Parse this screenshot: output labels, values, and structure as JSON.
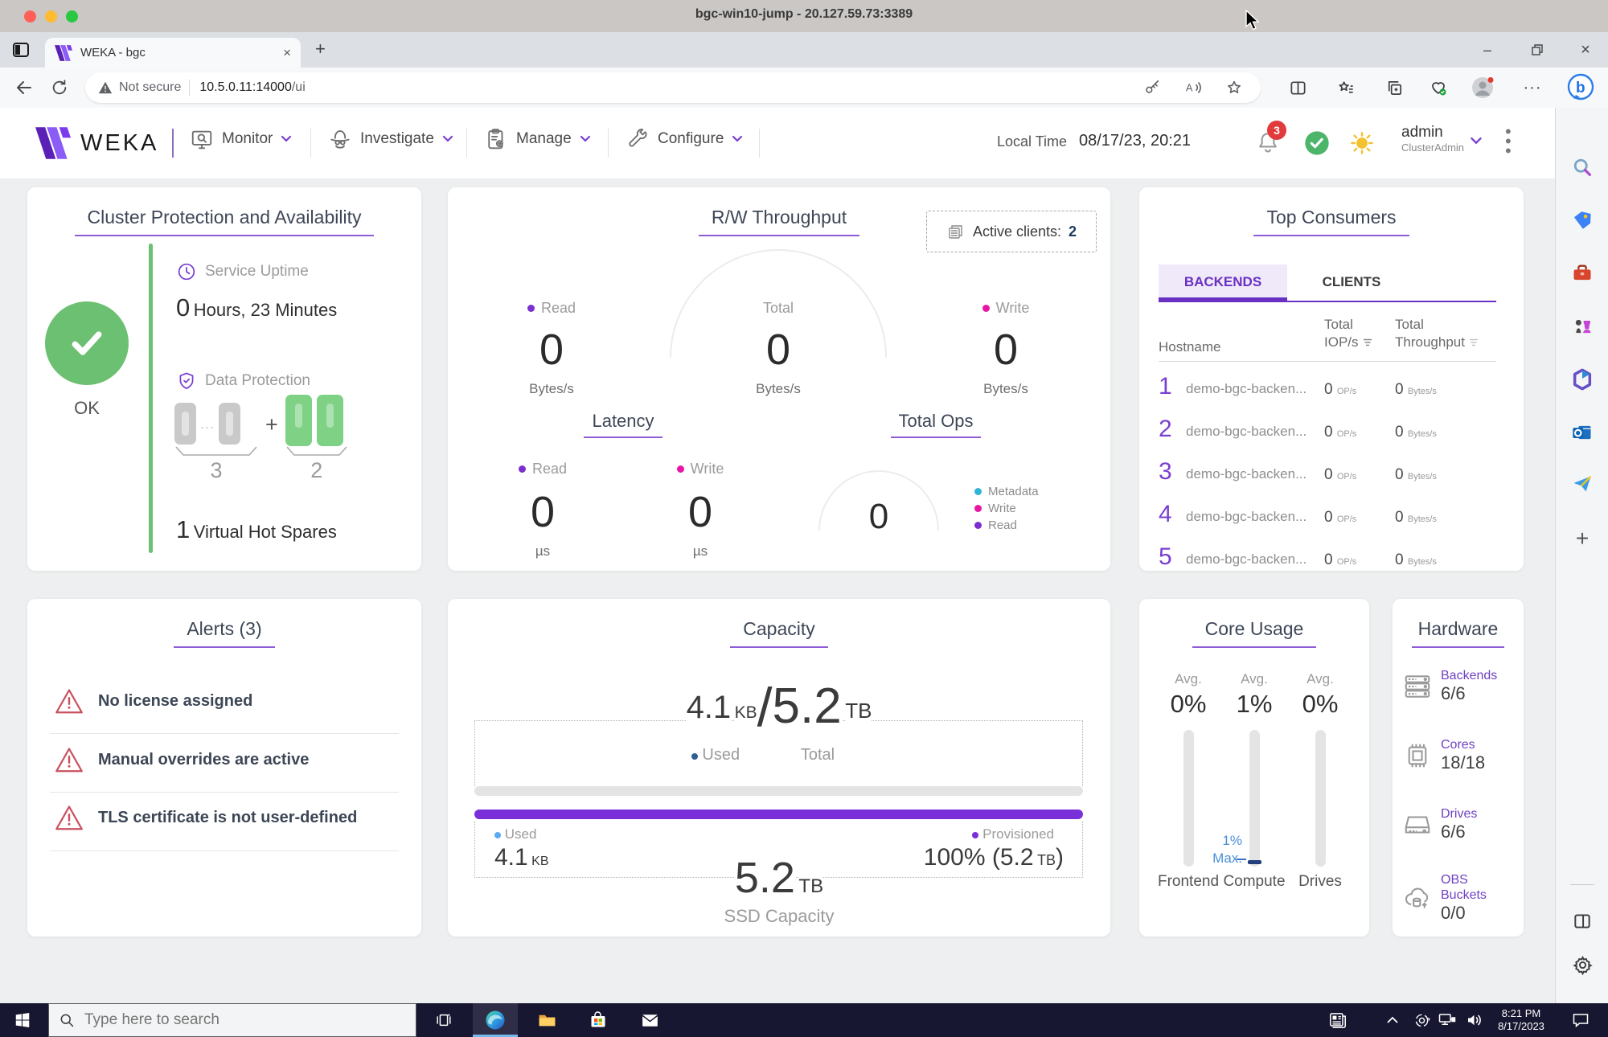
{
  "window": {
    "title": "bgc-win10-jump - 20.127.59.73:3389"
  },
  "glyphs": {
    "close": "×",
    "minimize": "–",
    "add": "+",
    "kebab": "⋮"
  },
  "browser": {
    "tab_title": "WEKA - bgc",
    "security_label": "Not secure",
    "url_host": "10.5.0.11:14000",
    "url_path": "/ui"
  },
  "nav": {
    "brand": "WEKA",
    "items": [
      {
        "label": "Monitor"
      },
      {
        "label": "Investigate"
      },
      {
        "label": "Manage"
      },
      {
        "label": "Configure"
      }
    ],
    "local_time_label": "Local Time",
    "local_time_value": "08/17/23, 20:21",
    "notifications_badge": "3",
    "user": {
      "name": "admin",
      "role": "ClusterAdmin"
    }
  },
  "cards": {
    "protection": {
      "title": "Cluster Protection and Availability",
      "status_label": "OK",
      "uptime_label": "Service Uptime",
      "uptime_value": "0",
      "uptime_text": "Hours, 23 Minutes",
      "data_protection_label": "Data Protection",
      "dots": "...",
      "plus": "+",
      "data_stripes": "3",
      "protection_stripes": "2",
      "spares_value": "1",
      "spares_text": "Virtual Hot Spares"
    },
    "throughput": {
      "title": "R/W Throughput",
      "active_clients_label": "Active clients:",
      "active_clients_value": "2",
      "cols": [
        {
          "label": "Read",
          "value": "0",
          "unit": "Bytes/s",
          "color": "#7b2fd0"
        },
        {
          "label": "Total",
          "value": "0",
          "unit": "Bytes/s",
          "color": ""
        },
        {
          "label": "Write",
          "value": "0",
          "unit": "Bytes/s",
          "color": "#e816a5"
        }
      ],
      "latency": {
        "title": "Latency",
        "cols": [
          {
            "label": "Read",
            "value": "0",
            "unit": "µs",
            "color": "#7b2fd0"
          },
          {
            "label": "Write",
            "value": "0",
            "unit": "µs",
            "color": "#e816a5"
          }
        ]
      },
      "total_ops": {
        "title": "Total Ops",
        "value": "0",
        "legend": [
          {
            "label": "Metadata",
            "color": "#2fb5d8"
          },
          {
            "label": "Write",
            "color": "#e816a5"
          },
          {
            "label": "Read",
            "color": "#7b2fd0"
          }
        ]
      }
    },
    "top_consumers": {
      "title": "Top Consumers",
      "tabs": [
        {
          "label": "BACKENDS"
        },
        {
          "label": "CLIENTS"
        }
      ],
      "columns": {
        "hostname": "Hostname",
        "iops_1": "Total",
        "iops_2": "IOP/s",
        "tp_1": "Total",
        "tp_2": "Throughput"
      },
      "rows": [
        {
          "rank": "1",
          "hostname": "demo-bgc-backen...",
          "iops": "0",
          "iops_unit": "OP/s",
          "tp": "0",
          "tp_unit": "Bytes/s"
        },
        {
          "rank": "2",
          "hostname": "demo-bgc-backen...",
          "iops": "0",
          "iops_unit": "OP/s",
          "tp": "0",
          "tp_unit": "Bytes/s"
        },
        {
          "rank": "3",
          "hostname": "demo-bgc-backen...",
          "iops": "0",
          "iops_unit": "OP/s",
          "tp": "0",
          "tp_unit": "Bytes/s"
        },
        {
          "rank": "4",
          "hostname": "demo-bgc-backen...",
          "iops": "0",
          "iops_unit": "OP/s",
          "tp": "0",
          "tp_unit": "Bytes/s"
        },
        {
          "rank": "5",
          "hostname": "demo-bgc-backen...",
          "iops": "0",
          "iops_unit": "OP/s",
          "tp": "0",
          "tp_unit": "Bytes/s"
        }
      ]
    },
    "alerts": {
      "title": "Alerts (3)",
      "items": [
        {
          "text": "No license assigned"
        },
        {
          "text": "Manual overrides are active"
        },
        {
          "text": "TLS certificate is not user-defined"
        }
      ]
    },
    "capacity": {
      "title": "Capacity",
      "used_value": "4.1",
      "used_unit": "KB",
      "slash": "/",
      "total_value": "5.2",
      "total_unit": "TB",
      "used_label": "Used",
      "total_label": "Total",
      "ssd_used_label": "Used",
      "ssd_used_value": "4.1",
      "ssd_used_unit": "KB",
      "ssd_total_value": "5.2",
      "ssd_total_unit": "TB",
      "ssd_caption": "SSD Capacity",
      "provisioned_label": "Provisioned",
      "provisioned_value": "100% (5.2",
      "provisioned_unit": "TB",
      "provisioned_close": ")"
    },
    "core_usage": {
      "title": "Core Usage",
      "avg_label": "Avg.",
      "cols": [
        {
          "value": "0%",
          "name": "Frontend"
        },
        {
          "value": "1%",
          "name": "Compute",
          "max_line1": "1%",
          "max_line2": "Max."
        },
        {
          "value": "0%",
          "name": "Drives"
        }
      ]
    },
    "hardware": {
      "title": "Hardware",
      "items": [
        {
          "label": "Backends",
          "value": "6/6"
        },
        {
          "label": "Cores",
          "value": "18/18"
        },
        {
          "label": "Drives",
          "value": "6/6"
        },
        {
          "label": "OBS Buckets",
          "value": "0/0"
        }
      ]
    }
  },
  "taskbar": {
    "search_placeholder": "Type here to search",
    "clock_time": "8:21 PM",
    "clock_date": "8/17/2023"
  }
}
